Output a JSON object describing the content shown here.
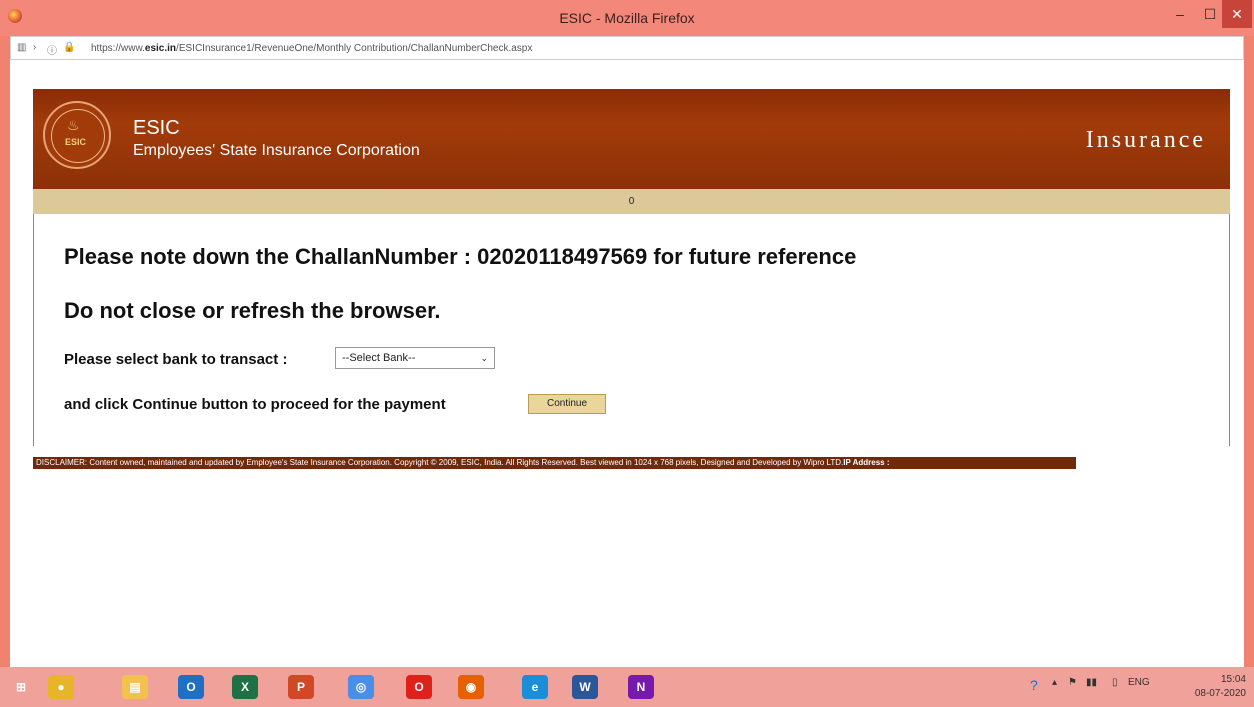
{
  "window": {
    "title": "ESIC - Mozilla Firefox",
    "min_icon": "minimize-icon",
    "max_icon": "maximize-icon",
    "close_icon": "close-icon",
    "min_glyph": "–",
    "max_glyph": "☐",
    "close_glyph": "✕"
  },
  "address_bar": {
    "url_prefix": "https://www.",
    "url_host": "esic.in",
    "url_path": "/ESICInsurance1/RevenueOne/Monthly Contribution/ChallanNumberCheck.aspx"
  },
  "header": {
    "brand_name": "ESIC",
    "brand_subtitle": "Employees' State Insurance Corporation",
    "section_label": "Insurance",
    "logo_text": "ESIC"
  },
  "status_strip": {
    "value": "0"
  },
  "main": {
    "challan_message": "Please note down the ChallanNumber : 02020118497569 for future reference",
    "warning_message": "Do not close or refresh the browser.",
    "bank_label": "Please select bank to transact :",
    "bank_select_value": "--Select Bank--",
    "continue_prompt": "and click Continue button to proceed for the payment",
    "continue_button": "Continue"
  },
  "footer": {
    "disclaimer": "DISCLAIMER: Content owned, maintained and updated by Employee's State Insurance Corporation. Copyright © 2009, ESIC, India. All Rights Reserved. Best viewed in 1024 x 768 pixels, Designed and Developed by Wipro LTD.",
    "ip_label": "IP Address :"
  },
  "taskbar": {
    "apps": [
      {
        "name": "windows-start-icon",
        "glyph": "⊞",
        "color": "#ffffff"
      },
      {
        "name": "chrome-icon",
        "glyph": "●",
        "color": "#e8b52a"
      },
      {
        "name": "file-explorer-icon",
        "glyph": "▤",
        "color": "#f2c14e"
      },
      {
        "name": "outlook-icon",
        "glyph": "O",
        "color": "#1f6fc5"
      },
      {
        "name": "excel-icon",
        "glyph": "X",
        "color": "#1e7145"
      },
      {
        "name": "powerpoint-icon",
        "glyph": "P",
        "color": "#d24726"
      },
      {
        "name": "chromium-icon",
        "glyph": "◎",
        "color": "#4a8fe7"
      },
      {
        "name": "opera-icon",
        "glyph": "O",
        "color": "#e0201b"
      },
      {
        "name": "firefox-icon",
        "glyph": "◉",
        "color": "#e66000"
      },
      {
        "name": "internet-explorer-icon",
        "glyph": "e",
        "color": "#1a8fd8"
      },
      {
        "name": "word-icon",
        "glyph": "W",
        "color": "#2b579a"
      },
      {
        "name": "onenote-icon",
        "glyph": "N",
        "color": "#7719aa"
      }
    ],
    "tray_lang": "ENG",
    "clock_time": "15:04",
    "clock_date": "08-07-2020"
  }
}
